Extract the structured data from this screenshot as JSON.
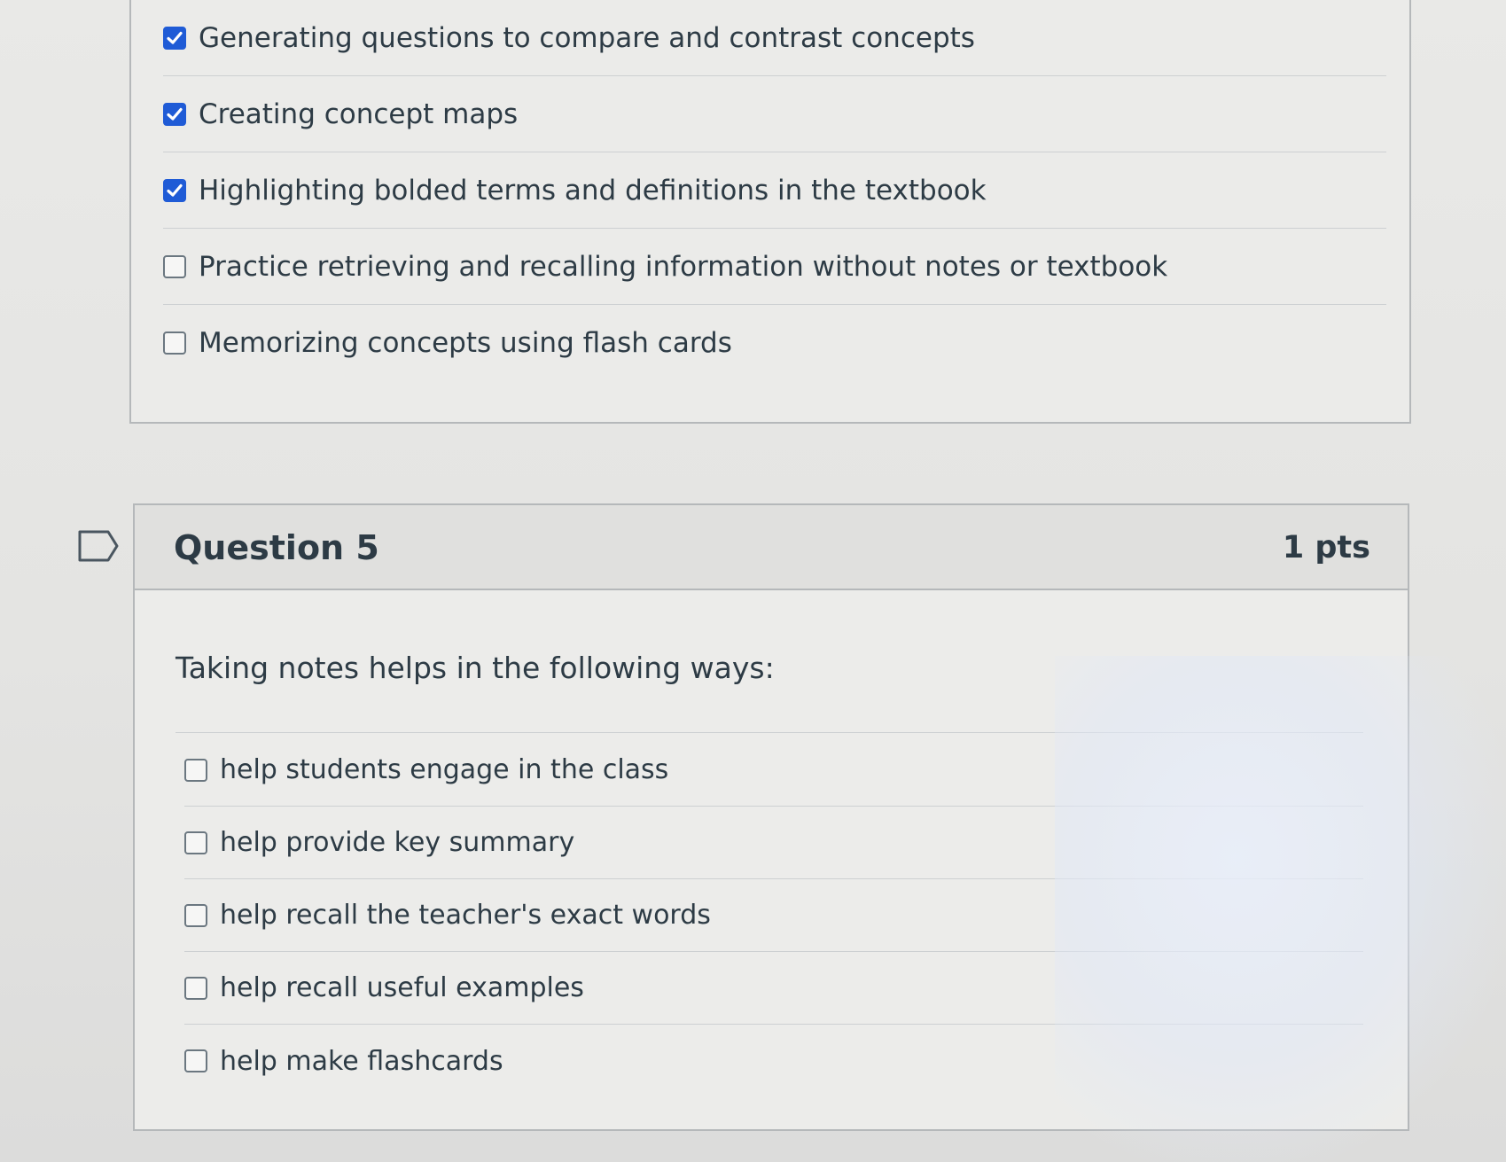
{
  "previous_question": {
    "answers": [
      {
        "label": "Generating questions to compare and contrast concepts",
        "checked": true
      },
      {
        "label": "Creating concept maps",
        "checked": true
      },
      {
        "label": "Highlighting bolded terms and definitions in the textbook",
        "checked": true
      },
      {
        "label": "Practice retrieving and recalling information without notes or textbook",
        "checked": false
      },
      {
        "label": "Memorizing concepts using flash cards",
        "checked": false
      }
    ]
  },
  "question": {
    "title": "Question 5",
    "points": "1 pts",
    "text": "Taking notes helps in the following ways:",
    "answers": [
      {
        "label": "help students engage in the class",
        "checked": false
      },
      {
        "label": "help provide key summary",
        "checked": false
      },
      {
        "label": "help recall the teacher's exact words",
        "checked": false
      },
      {
        "label": "help recall useful examples",
        "checked": false
      },
      {
        "label": "help make flashcards",
        "checked": false
      }
    ]
  },
  "icons": {
    "flag": "flag-bookmark-icon",
    "checkmark": "checkmark-icon"
  },
  "colors": {
    "checked_box": "#1f5bd6",
    "text": "#2d3b45",
    "border": "#b5b8ba"
  }
}
